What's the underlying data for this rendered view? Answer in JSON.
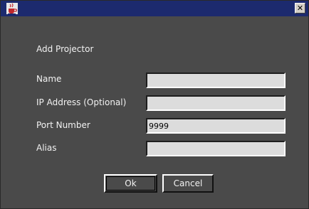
{
  "window": {
    "close_glyph": "✕",
    "app_icon": "java-coffee-cup-icon"
  },
  "dialog": {
    "title": "Add Projector"
  },
  "fields": [
    {
      "label": "Name",
      "value": ""
    },
    {
      "label": "IP Address (Optional)",
      "value": ""
    },
    {
      "label": "Port Number",
      "value": "9999"
    },
    {
      "label": "Alias",
      "value": ""
    }
  ],
  "buttons": {
    "ok": "Ok",
    "cancel": "Cancel"
  },
  "colors": {
    "titlebar": "#1c2a6e",
    "background": "#4a4a4a",
    "field": "#dcdcdc",
    "text": "#f2f2f2"
  }
}
